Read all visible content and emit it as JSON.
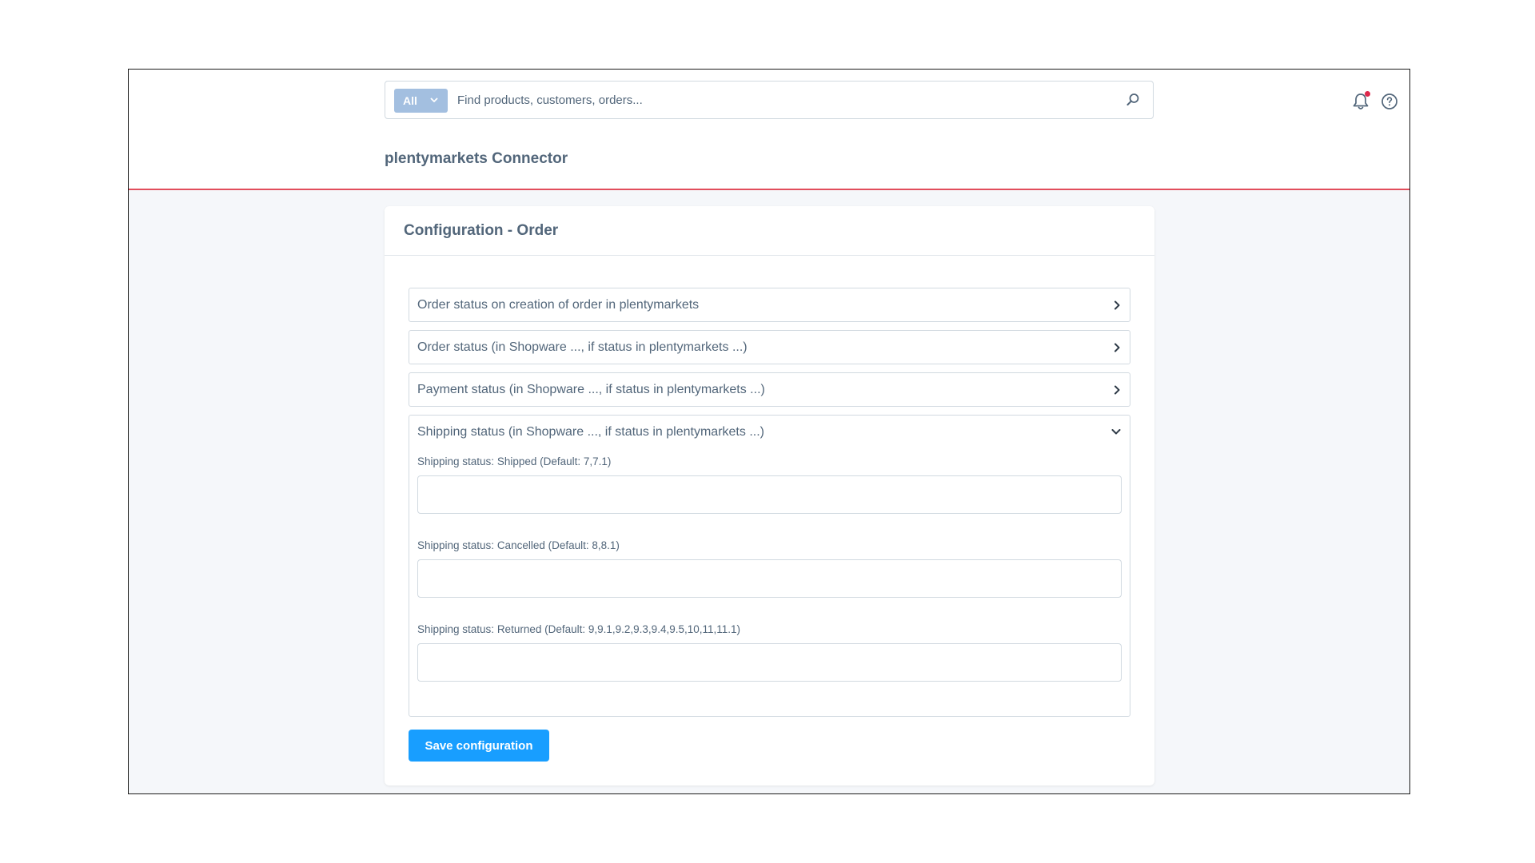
{
  "search": {
    "type_label": "All",
    "placeholder": "Find products, customers, orders..."
  },
  "header": {
    "title": "plentymarkets Connector"
  },
  "card": {
    "title": "Configuration - Order",
    "sections": [
      {
        "label": "Order status on creation of order in plentymarkets",
        "expanded": false
      },
      {
        "label": "Order status (in Shopware ..., if status in plentymarkets ...)",
        "expanded": false
      },
      {
        "label": "Payment status (in Shopware ..., if status in plentymarkets ...)",
        "expanded": false
      },
      {
        "label": "Shipping status (in Shopware ..., if status in plentymarkets ...)",
        "expanded": true,
        "fields": [
          {
            "label": "Shipping status: Shipped (Default: 7,7.1)",
            "value": ""
          },
          {
            "label": "Shipping status: Cancelled (Default: 8,8.1)",
            "value": ""
          },
          {
            "label": "Shipping status: Returned (Default: 9,9.1,9.2,9.3,9.4,9.5,10,11,11.1)",
            "value": ""
          }
        ]
      }
    ],
    "save_label": "Save configuration"
  },
  "colors": {
    "accent": "#189eff",
    "header_border": "#e24e5c",
    "notification_dot": "#de294c",
    "search_type_bg": "#a3bfe0"
  }
}
